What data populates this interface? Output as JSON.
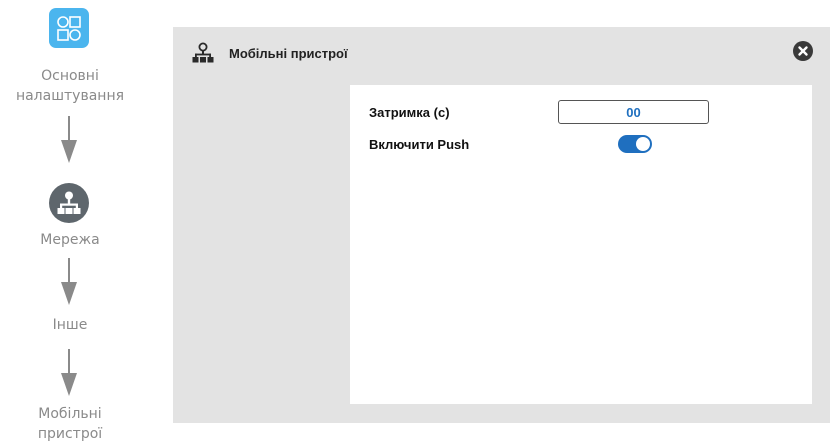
{
  "wizard": {
    "steps": [
      {
        "label_lines": [
          "Основні",
          "налаштування"
        ],
        "icon": "apps-icon"
      },
      {
        "label_lines": [
          "Мережа"
        ],
        "icon": "network-icon"
      },
      {
        "label_lines": [
          "Інше"
        ],
        "icon": ""
      },
      {
        "label_lines": [
          "Мобільні",
          "пристрої"
        ],
        "icon": ""
      }
    ]
  },
  "panel": {
    "title": "Мобільні пристрої",
    "icon": "network-icon",
    "close_icon": "close-icon"
  },
  "form": {
    "delay_label": "Затримка (с)",
    "delay_value": "00",
    "push_label": "Включити Push",
    "push_enabled": true
  },
  "colors": {
    "accent": "#1f6fbf",
    "apps_icon_bg": "#4bb5ee",
    "network_icon_bg": "#5e666c",
    "panel_bg": "#e3e3e3",
    "muted_text": "#8a8a8a"
  }
}
